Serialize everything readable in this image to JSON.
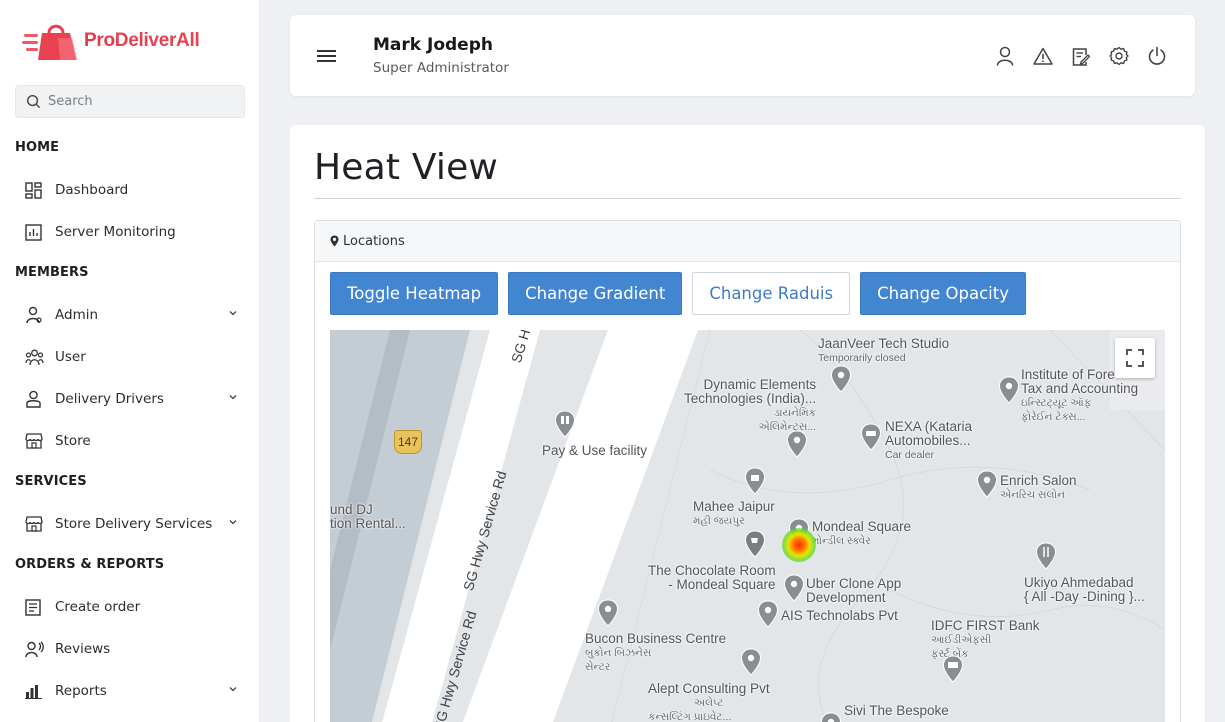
{
  "brand": {
    "name_prefix": "Pro",
    "name_suffix": "DeliverAll"
  },
  "search": {
    "placeholder": "Search"
  },
  "sidebar": {
    "sections": [
      {
        "title": "HOME"
      },
      {
        "title": "MEMBERS"
      },
      {
        "title": "SERVICES"
      },
      {
        "title": "ORDERS & REPORTS"
      }
    ],
    "items": [
      {
        "label": "Dashboard",
        "icon": "dashboard-icon"
      },
      {
        "label": "Server Monitoring",
        "icon": "server-monitor-icon"
      },
      {
        "label": "Admin",
        "icon": "admin-user-icon",
        "expandable": true
      },
      {
        "label": "User",
        "icon": "users-group-icon"
      },
      {
        "label": "Delivery Drivers",
        "icon": "driver-icon",
        "expandable": true
      },
      {
        "label": "Store",
        "icon": "store-icon"
      },
      {
        "label": "Store Delivery Services",
        "icon": "store-icon",
        "expandable": true
      },
      {
        "label": "Create order",
        "icon": "order-list-icon"
      },
      {
        "label": "Reviews",
        "icon": "reviews-icon"
      },
      {
        "label": "Reports",
        "icon": "bar-chart-icon",
        "expandable": true
      }
    ]
  },
  "header": {
    "user_name": "Mark Jodeph",
    "user_role": "Super Administrator",
    "icons": [
      "profile-icon",
      "alert-icon",
      "edit-note-icon",
      "settings-icon",
      "power-icon"
    ]
  },
  "main": {
    "title": "Heat View",
    "panel_title": "Locations",
    "buttons": {
      "toggle_heatmap": "Toggle Heatmap",
      "change_gradient": "Change Gradient",
      "change_radius": "Change Raduis",
      "change_opacity": "Change Opacity"
    }
  },
  "map": {
    "route_number": "147",
    "roads": [
      "SG Hwy Servi",
      "SG Hwy Service Rd",
      "SG Hwy Service Rd"
    ],
    "places": [
      {
        "name": "JaanVeer Tech Studio",
        "sub": "Temporarily closed"
      },
      {
        "name": "Dynamic Elements",
        "name2": "Technologies (India)...",
        "sub": "ડાયનેમિક",
        "sub2": "એલિમેન્ટ્સ..."
      },
      {
        "name": "Institute of Fore",
        "name2": "Tax and Accounting",
        "sub": "ઇન્સ્ટિટ્યૂટ ઑફ",
        "sub2": "ફોરેઈન ટૅક્સ..."
      },
      {
        "name": "Pay & Use facility"
      },
      {
        "name": "NEXA (Kataria",
        "name2": "Automobiles...",
        "sub": "Car dealer"
      },
      {
        "name": "Enrich Salon",
        "sub": "એનરિચ સલોન"
      },
      {
        "name": "Mahee Jaipur",
        "sub": "મહી જયપુર"
      },
      {
        "name": "Mondeal Square",
        "sub": "મોન્ડીલ સ્ક્વેર"
      },
      {
        "name": "The Chocolate Room",
        "name2": "- Mondeal Square"
      },
      {
        "name": "Uber Clone App",
        "name2": "Development"
      },
      {
        "name": "Ukiyo Ahmedabad",
        "name2": "{ All -Day -Dining }..."
      },
      {
        "name": "AIS Technolabs Pvt"
      },
      {
        "name": "IDFC FIRST Bank",
        "sub": "આઈડીએફસી",
        "sub2": "ફર્સ્ટ બેંક"
      },
      {
        "name": "Bucon Business Centre",
        "sub": "બુકોન બિઝનેસ",
        "sub2": "સેન્ટર"
      },
      {
        "name": "Alept Consulting Pvt",
        "sub": "અલેપ્ટ",
        "sub2": "કન્સલ્ટિંગ પ્રાઇવેટ..."
      },
      {
        "name": "Sivi The Bespoke"
      },
      {
        "name": "und DJ",
        "name2": "tion Rental..."
      }
    ],
    "heatmap_level": 1,
    "colors": {
      "road": "#ffffff",
      "land": "#e3e6e9",
      "water": "#c4ccd4",
      "pin": "#8a8d91"
    }
  },
  "colors": {
    "primary": "#4285d0",
    "brand": "#e8414f"
  }
}
